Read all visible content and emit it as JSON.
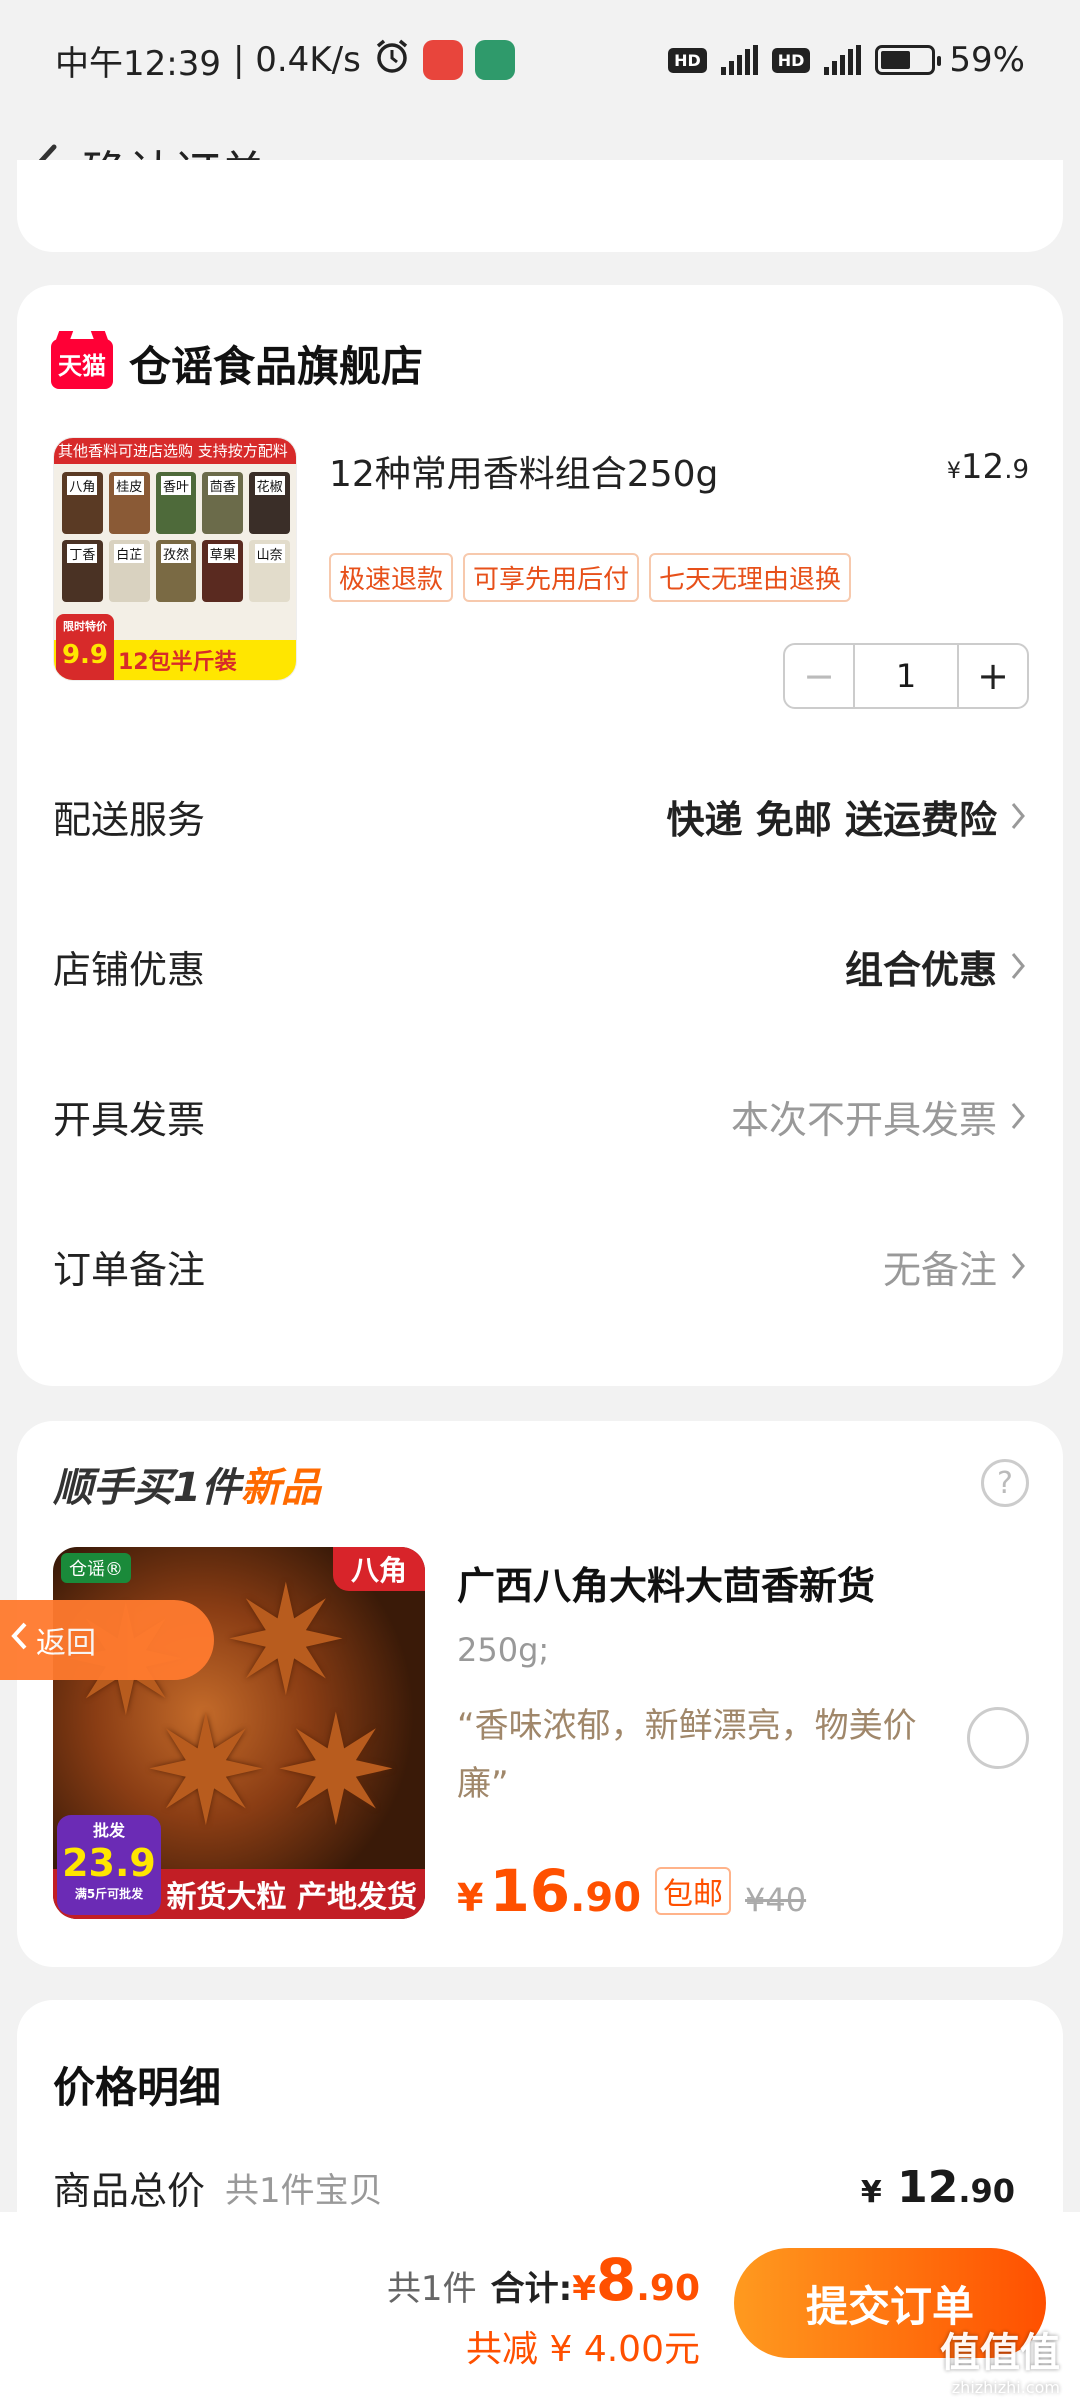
{
  "status_bar": {
    "time": "中午12:39",
    "speed": "| 0.4K/s",
    "battery_text": "59%",
    "battery_level": 0.59
  },
  "header": {
    "title": "确认订单"
  },
  "store": {
    "name": "仓谣食品旗舰店",
    "logo_text": "天猫",
    "product": {
      "title": "12种常用香料组合250g",
      "price_currency": "¥",
      "price_int": "12",
      "price_dec": ".9",
      "image_top_text": "其他香料可进店选购 支持按方配料",
      "image_labels": [
        "八角",
        "桂皮",
        "香叶",
        "茴香",
        "花椒",
        "丁香",
        "白芷",
        "孜然",
        "草果",
        "山奈"
      ],
      "image_badge_top": "限时特价",
      "image_badge_price": "9.9",
      "image_bottom_text": "12包半斤装",
      "tags": [
        "极速退款",
        "可享先用后付",
        "七天无理由退换"
      ],
      "quantity": "1"
    },
    "rows": [
      {
        "label": "配送服务",
        "value": "快递 免邮 送运费险",
        "style": "bold"
      },
      {
        "label": "店铺优惠",
        "value": "组合优惠",
        "style": "bold"
      },
      {
        "label": "开具发票",
        "value": "本次不开具发票",
        "style": "muted"
      },
      {
        "label": "订单备注",
        "value": "无备注",
        "style": "muted"
      }
    ]
  },
  "addon": {
    "title_main": "顺手买1件",
    "title_new": "新品",
    "help": "?",
    "name": "广西八角大料大茴香新货",
    "spec": "250g;",
    "desc": "“香味浓郁，新鲜漂亮，物美价廉”",
    "price_currency": "¥",
    "price_int": "16",
    "price_dec": ".90",
    "free_shipping": "包邮",
    "orig_price": "¥40",
    "image_brand": "仓谣®",
    "image_tag": "八角",
    "image_badge_top": "批发",
    "image_badge_price": "23.9",
    "image_badge_bottom": "满5斤可批发",
    "image_bottom_text": "新货大粒 产地发货"
  },
  "back_float": {
    "label": "返回"
  },
  "price_detail": {
    "title": "价格明细",
    "goods_label": "商品总价",
    "goods_sub": "共1件宝贝",
    "goods_currency": "¥",
    "goods_int": "12",
    "goods_dec": ".90"
  },
  "bottom_bar": {
    "count": "共1件",
    "total_label": "合计:",
    "total_currency": "¥",
    "total_int": "8",
    "total_dec": ".90",
    "saved": "共减 ¥ 4.00元",
    "submit": "提交订单"
  },
  "watermark": {
    "main": "值值值",
    "sub": "zhizhizhi.com"
  },
  "colors": {
    "accent": "#ff5000",
    "tmall": "#ff0036",
    "background": "#f2f2f2"
  }
}
